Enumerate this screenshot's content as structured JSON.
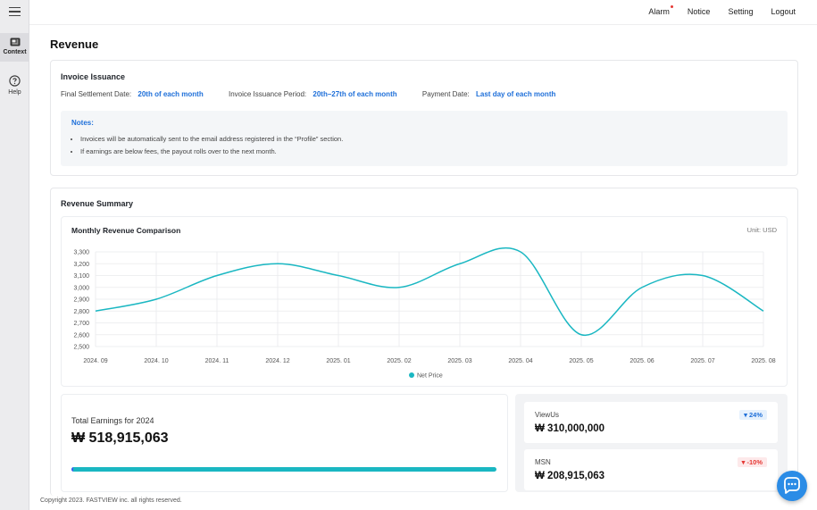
{
  "sidebar": {
    "items": [
      {
        "label": "Context",
        "icon": "newspaper-icon"
      },
      {
        "label": "Help",
        "icon": "question-circle-icon"
      }
    ]
  },
  "topnav": {
    "alarm": "Alarm",
    "notice": "Notice",
    "setting": "Setting",
    "logout": "Logout"
  },
  "page": {
    "title": "Revenue"
  },
  "invoice": {
    "title": "Invoice Issuance",
    "final_settlement_label": "Final Settlement Date:",
    "final_settlement_value": "20th of each month",
    "issuance_period_label": "Invoice Issuance Period:",
    "issuance_period_value": "20th–27th of each month",
    "payment_date_label": "Payment Date:",
    "payment_date_value": "Last day of each month",
    "notes_title": "Notes:",
    "notes": [
      "Invoices will be automatically sent to the email address registered in the “Profile” section.",
      "If earnings are below fees, the payout rolls over to the next month."
    ]
  },
  "summary": {
    "title": "Revenue Summary"
  },
  "chart_data": {
    "type": "line",
    "title": "Monthly Revenue Comparison",
    "unit": "Unit: USD",
    "categories": [
      "2024. 09",
      "2024. 10",
      "2024. 11",
      "2024. 12",
      "2025. 01",
      "2025. 02",
      "2025. 03",
      "2025. 04",
      "2025. 05",
      "2025. 06",
      "2025. 07",
      "2025. 08"
    ],
    "series": [
      {
        "name": "Net Price",
        "color": "#1ab7c2",
        "values": [
          2800,
          2900,
          3100,
          3200,
          3100,
          3000,
          3200,
          3300,
          2600,
          3000,
          3100,
          2800
        ]
      }
    ],
    "ylim": [
      2500,
      3300
    ],
    "yticks": [
      2500,
      2600,
      2700,
      2800,
      2900,
      3000,
      3100,
      3200,
      3300
    ],
    "ytick_labels": [
      "2,500",
      "2,600",
      "2,700",
      "2,800",
      "2,900",
      "3,000",
      "3,100",
      "3,200",
      "3,300"
    ],
    "grid": true,
    "legend": "bottom-center"
  },
  "earnings": {
    "label": "Total Earnings for 2024",
    "value": "₩ 518,915,063",
    "progress": 1.0
  },
  "platforms": [
    {
      "name": "ViewUs",
      "value": "₩ 310,000,000",
      "change": "24%",
      "direction": "up"
    },
    {
      "name": "MSN",
      "value": "₩ 208,915,063",
      "change": "-10%",
      "direction": "down"
    }
  ],
  "footer": {
    "copyright": "Copyright  2023. FASTVIEW inc. all rights reserved."
  },
  "colors": {
    "accent": "#1e6fd9",
    "line": "#1ab7c2",
    "chat": "#2b8ce6"
  }
}
